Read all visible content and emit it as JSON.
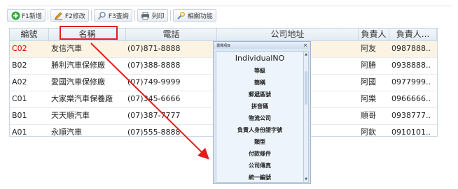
{
  "toolbar": {
    "buttons": [
      {
        "label": "F1新增",
        "icon": "add-icon",
        "color": "#2fa83a"
      },
      {
        "label": "F2修改",
        "icon": "edit-icon",
        "color": "#e2a31d"
      },
      {
        "label": "F3查詢",
        "icon": "search-icon",
        "color": "#6b7fa0"
      },
      {
        "label": "列印",
        "icon": "print-icon",
        "color": "#5c6a7a"
      },
      {
        "label": "相關功能",
        "icon": "tools-icon",
        "color": "#4a8ad0"
      }
    ]
  },
  "grid": {
    "columns": [
      "編號",
      "名稱",
      "電話",
      "公司地址",
      "負責人",
      "負責人..."
    ],
    "rows": [
      {
        "code": "C02",
        "name": "友信汽車",
        "tel": "(07)871-8888",
        "addr": "",
        "manager": "阿友",
        "mtel": "0987888.."
      },
      {
        "code": "B02",
        "name": "勝利汽車保修廠",
        "tel": "(07)388-8888",
        "addr": "",
        "manager": "阿勝",
        "mtel": "0938888.."
      },
      {
        "code": "A02",
        "name": "愛國汽車保修廠",
        "tel": "(07)749-9999",
        "addr": "",
        "manager": "阿國",
        "mtel": "0977999.."
      },
      {
        "code": "C01",
        "name": "大家樂汽車保養廠",
        "tel": "(07)345-6666",
        "addr": "",
        "manager": "阿樂",
        "mtel": "0966666.."
      },
      {
        "code": "B01",
        "name": "天天順汽車",
        "tel": "(07)387-7777",
        "addr": "",
        "manager": "順哥",
        "mtel": "0938777.."
      },
      {
        "code": "A01",
        "name": "永順汽車",
        "tel": "(07)555-8888",
        "addr": "",
        "manager": "阿欽",
        "mtel": "0910101.."
      }
    ]
  },
  "popup": {
    "title": "選擇項目",
    "close": "×",
    "items": [
      "IndividualNO",
      "等級",
      "簡稱",
      "郵遞區號",
      "拼音碼",
      "物流公司",
      "負責人身份證字號",
      "類型",
      "付款條件",
      "公司傳真",
      "統一編號"
    ]
  },
  "colors": {
    "highlight": "#e21d1d",
    "selected_code": "#d40000"
  }
}
